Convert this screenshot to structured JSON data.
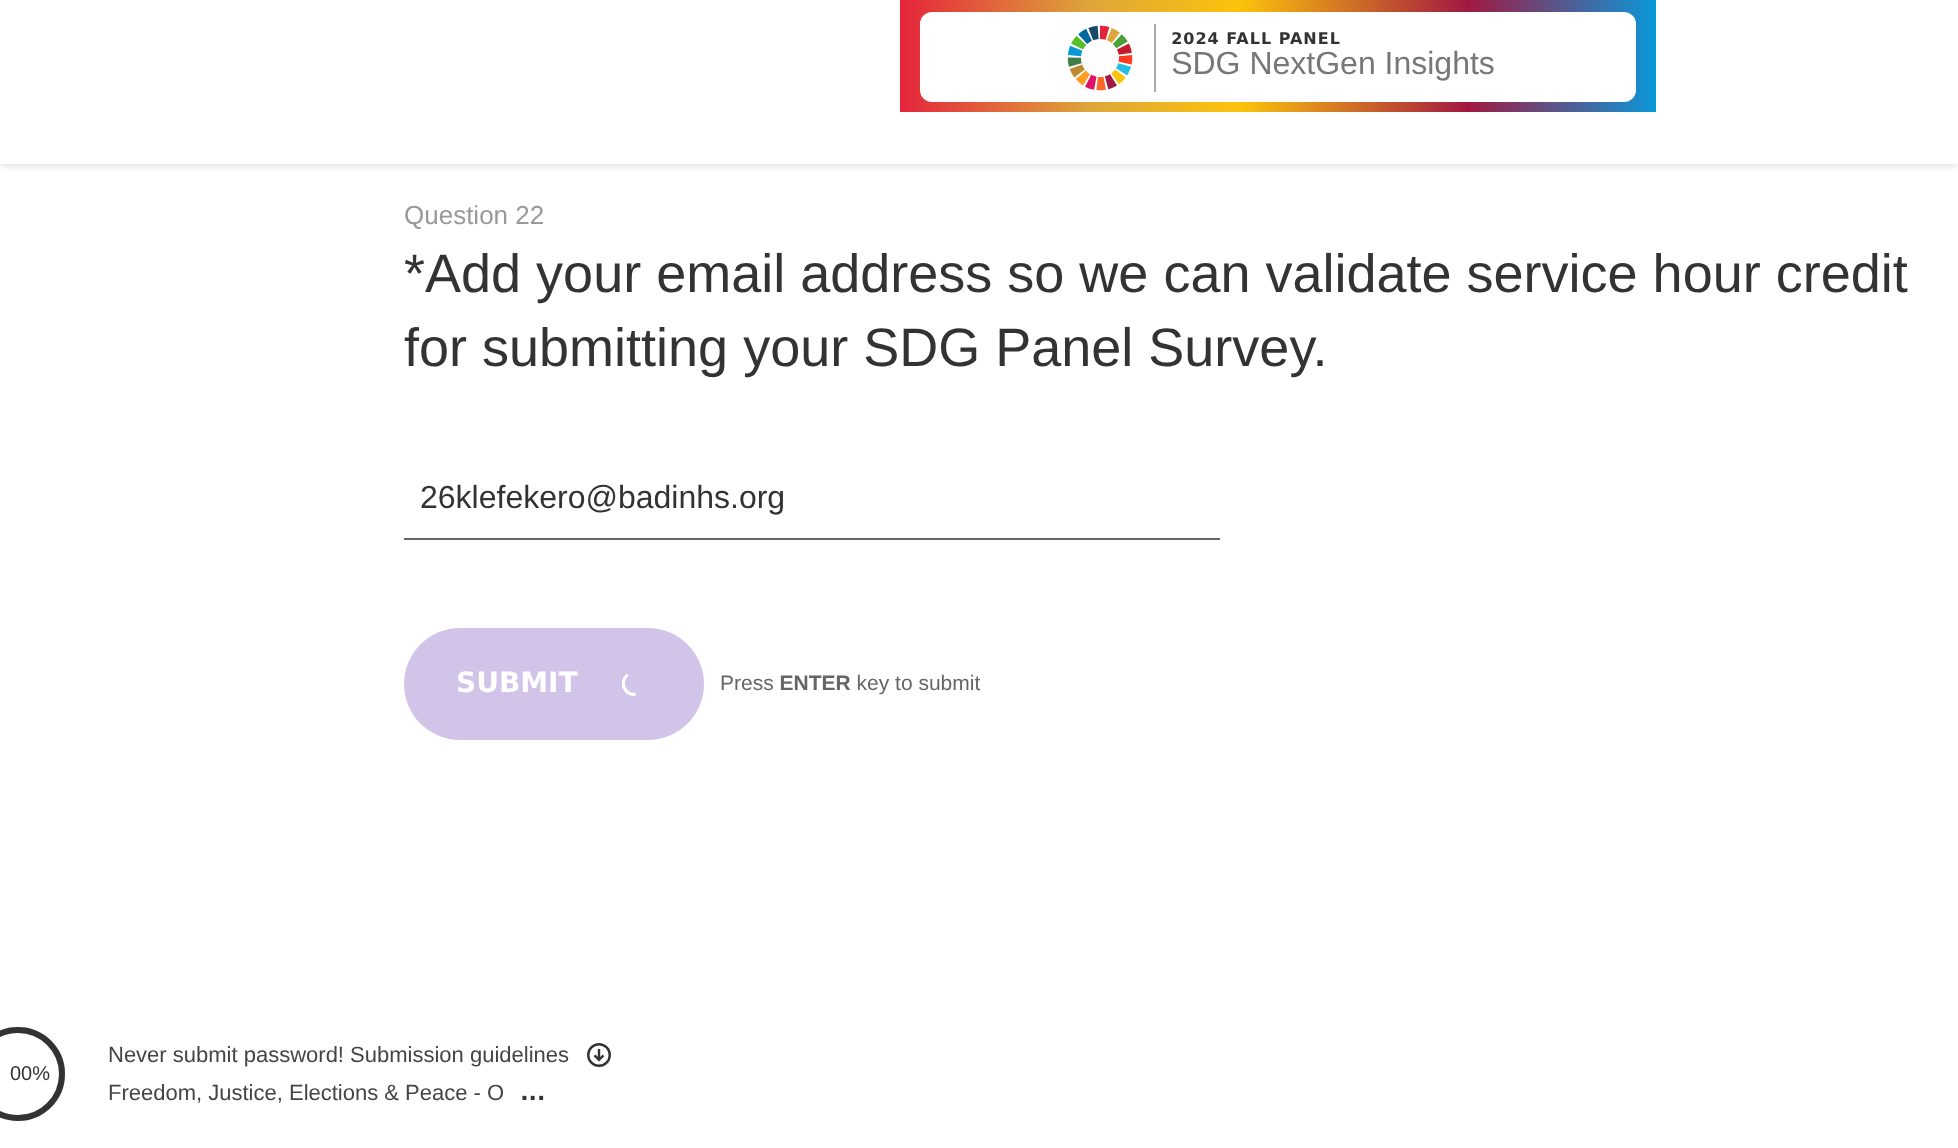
{
  "banner": {
    "kicker": "2024 FALL PANEL",
    "title": "SDG NextGen Insights"
  },
  "question": {
    "number": "Question 22",
    "text": "*Add your email address so we can validate service hour credit for submitting your SDG Panel Survey.",
    "value": "26klefekero@badinhs.org"
  },
  "submit": {
    "label": "SUBMIT",
    "loading": true,
    "hint": "Press **ENTER** key to submit"
  },
  "footer": {
    "progress": {
      "label": "00%"
    },
    "notice": "Never submit password! Submission guidelines",
    "section": "Freedom, Justice, Elections & Peace - O",
    "more": "..."
  }
}
